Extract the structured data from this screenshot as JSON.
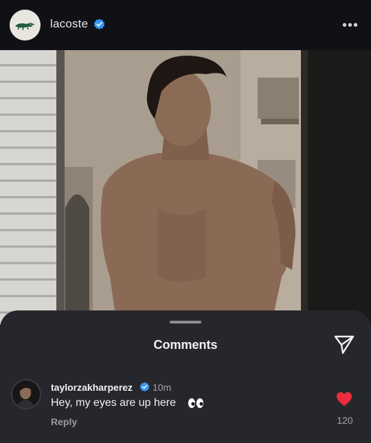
{
  "header": {
    "username": "lacoste",
    "verified": true,
    "more_icon": "more-horizontal-icon"
  },
  "colors": {
    "verified_blue": "#3897f0",
    "heart_red": "#ed2d3b",
    "sheet_bg": "#26272c"
  },
  "sheet": {
    "title": "Comments",
    "send_icon": "paper-plane-icon"
  },
  "comment": {
    "username": "taylorzakharperez",
    "verified": true,
    "time": "10m",
    "text": "Hey, my eyes are up here",
    "emoji": "eyes-emoji",
    "reply_label": "Reply",
    "like_count": "120",
    "liked": true
  }
}
